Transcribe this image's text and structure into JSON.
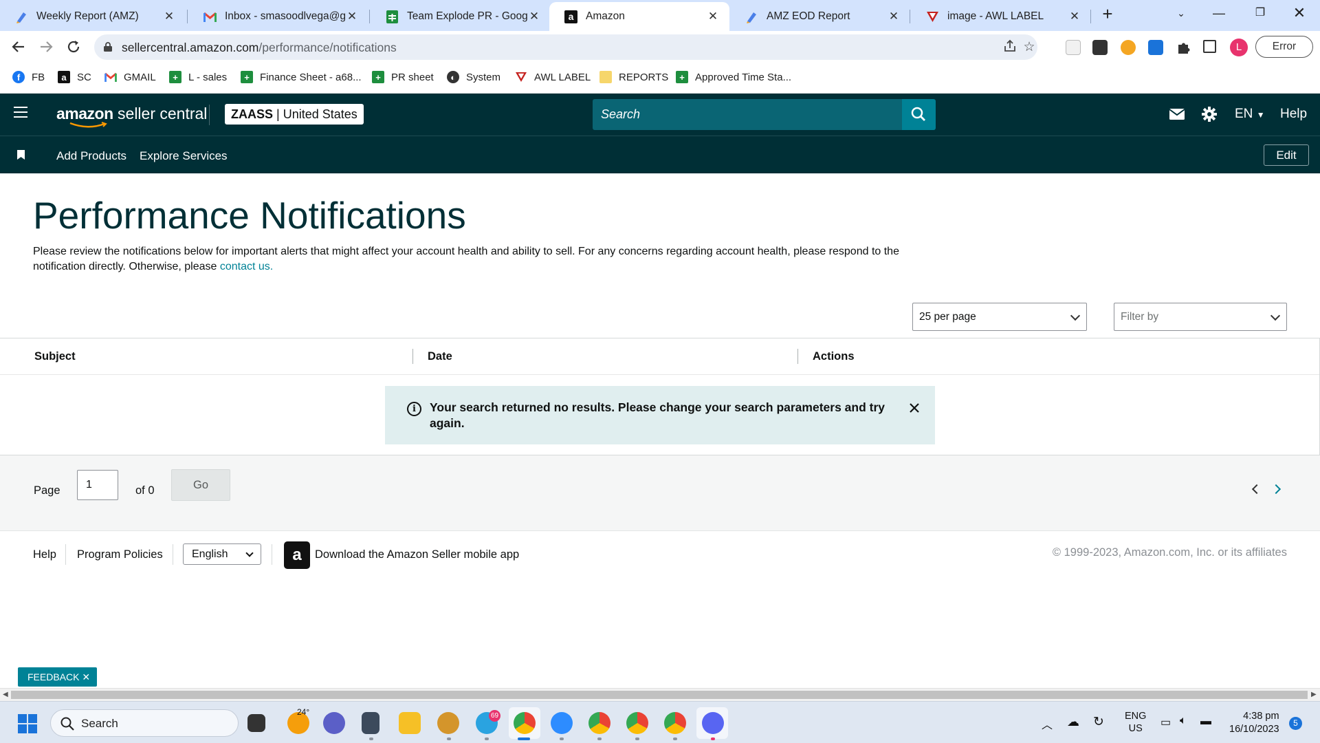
{
  "browser": {
    "tabs": [
      {
        "title": "Weekly Report (AMZ)",
        "icon": "pen-icon",
        "active": false
      },
      {
        "title": "Inbox - smasoodlvega@gmail.com",
        "icon": "gmail-icon",
        "active": false
      },
      {
        "title": "Team Explode PR - Google Sheets",
        "icon": "sheets-icon",
        "active": false
      },
      {
        "title": "Amazon",
        "icon": "amazon-icon",
        "active": true
      },
      {
        "title": "AMZ EOD Report",
        "icon": "pen-icon",
        "active": false
      },
      {
        "title": "image - AWL LABEL",
        "icon": "awl-icon",
        "active": false
      }
    ],
    "url_domain": "sellercentral.amazon.com",
    "url_path": "/performance/notifications",
    "profile_initial": "L",
    "error_label": "Error",
    "bookmarks": [
      {
        "label": "FB",
        "icon": "facebook-icon",
        "color": "#1877f2"
      },
      {
        "label": "SC",
        "icon": "amazon-icon",
        "color": "#111111"
      },
      {
        "label": "GMAIL",
        "icon": "gmail-icon",
        "color": "#ea4335"
      },
      {
        "label": "L - sales",
        "icon": "sheets-icon",
        "color": "#1e8e3e"
      },
      {
        "label": "Finance Sheet - a68...",
        "icon": "sheets-icon",
        "color": "#1e8e3e"
      },
      {
        "label": "PR sheet",
        "icon": "sheets-icon",
        "color": "#1e8e3e"
      },
      {
        "label": "System",
        "icon": "globe-icon",
        "color": "#333333"
      },
      {
        "label": "AWL LABEL",
        "icon": "awl-icon",
        "color": "#c5221f"
      },
      {
        "label": "REPORTS",
        "icon": "folder-icon",
        "color": "#f6d66b"
      },
      {
        "label": "Approved Time Sta...",
        "icon": "sheets-icon",
        "color": "#1e8e3e"
      }
    ]
  },
  "header": {
    "logo_brand": "amazon",
    "logo_product": "seller central",
    "store_name": "ZAASS",
    "store_region": "United States",
    "search_placeholder": "Search",
    "language": "EN",
    "help": "Help"
  },
  "subnav": {
    "links": [
      "Add Products",
      "Explore Services"
    ],
    "edit": "Edit"
  },
  "page": {
    "title": "Performance Notifications",
    "description": "Please review the notifications below for important alerts that might affect your account health and ability to sell. For any concerns regarding account health, please respond to the notification directly. Otherwise, please",
    "contact_link": "contact us.",
    "per_page": "25 per page",
    "filter_placeholder": "Filter by",
    "columns": [
      "Subject",
      "Date",
      "Actions"
    ],
    "alert": "Your search returned no results. Please change your search parameters and try again.",
    "pager": {
      "page_label": "Page",
      "current": "1",
      "of_label": "of 0",
      "go": "Go"
    }
  },
  "footer": {
    "help": "Help",
    "program_policies": "Program Policies",
    "language": "English",
    "app_link": "Download the Amazon Seller mobile app",
    "copyright": "© 1999-2023, Amazon.com, Inc. or its affiliates"
  },
  "feedback": "FEEDBACK",
  "taskbar": {
    "search": "Search",
    "weather": "24°",
    "telegram_badge": "69",
    "lang_top": "ENG",
    "lang_bottom": "US",
    "time": "4:38 pm",
    "date": "16/10/2023",
    "notif_count": "5"
  },
  "colors": {
    "header_bg": "#002f36",
    "accent": "#008296",
    "alert_bg": "#e0eeef"
  }
}
